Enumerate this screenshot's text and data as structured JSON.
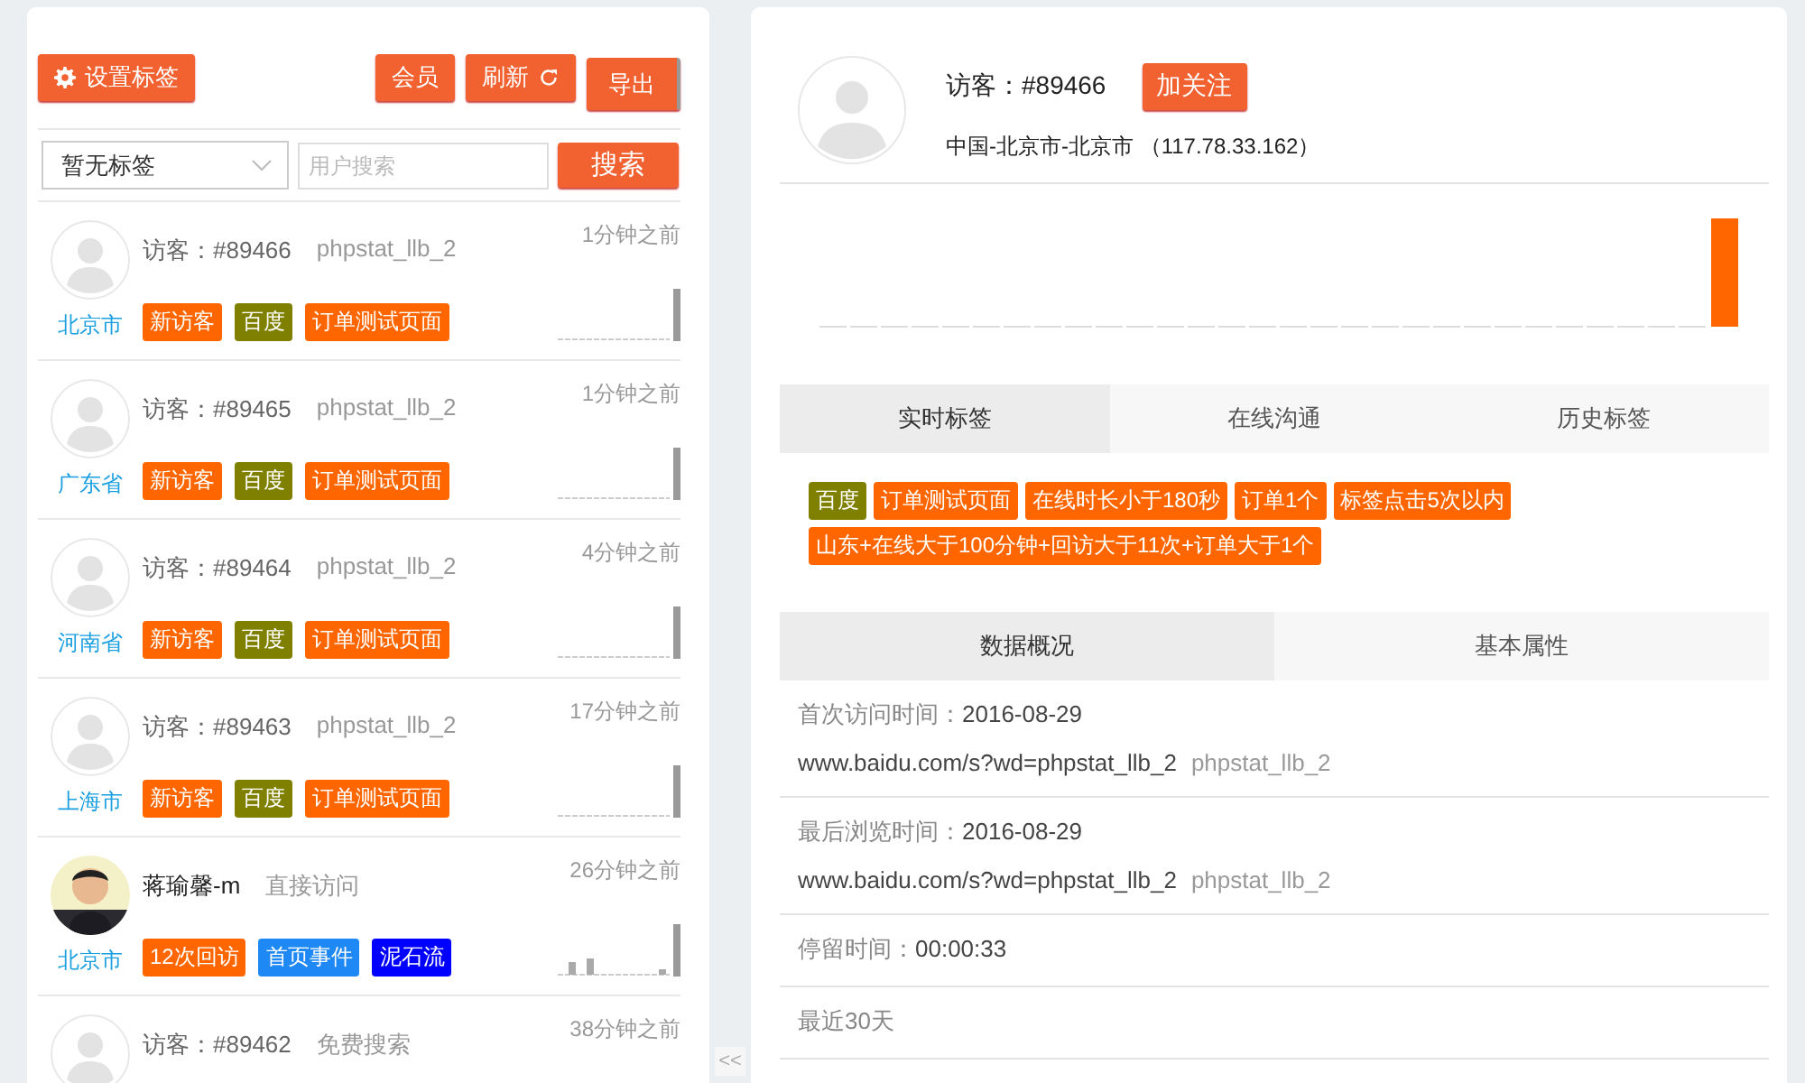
{
  "toolbar": {
    "buttons": [
      {
        "label": "设置标签",
        "kind": "settings"
      },
      {
        "label": "会员",
        "kind": "plain"
      },
      {
        "label": "刷新",
        "kind": "refresh"
      },
      {
        "label": "导出",
        "kind": "export"
      }
    ]
  },
  "filter": {
    "select_value": "暂无标签",
    "search_placeholder": "用户搜索",
    "search_button": "搜索"
  },
  "visitors": [
    {
      "kind": "anonymous",
      "name": "访客：#89466",
      "source": "phpstat_llb_2",
      "time": "1分钟之前",
      "location": "北京市",
      "tags": [
        {
          "label": "新访客",
          "color": "#ff6600"
        },
        {
          "label": "百度",
          "color": "#808000"
        },
        {
          "label": "订单测试页面",
          "color": "#ff6600"
        }
      ]
    },
    {
      "kind": "anonymous",
      "name": "访客：#89465",
      "source": "phpstat_llb_2",
      "time": "1分钟之前",
      "location": "广东省",
      "tags": [
        {
          "label": "新访客",
          "color": "#ff6600"
        },
        {
          "label": "百度",
          "color": "#808000"
        },
        {
          "label": "订单测试页面",
          "color": "#ff6600"
        }
      ]
    },
    {
      "kind": "anonymous",
      "name": "访客：#89464",
      "source": "phpstat_llb_2",
      "time": "4分钟之前",
      "location": "河南省",
      "tags": [
        {
          "label": "新访客",
          "color": "#ff6600"
        },
        {
          "label": "百度",
          "color": "#808000"
        },
        {
          "label": "订单测试页面",
          "color": "#ff6600"
        }
      ]
    },
    {
      "kind": "anonymous",
      "name": "访客：#89463",
      "source": "phpstat_llb_2",
      "time": "17分钟之前",
      "location": "上海市",
      "tags": [
        {
          "label": "新访客",
          "color": "#ff6600"
        },
        {
          "label": "百度",
          "color": "#808000"
        },
        {
          "label": "订单测试页面",
          "color": "#ff6600"
        }
      ]
    },
    {
      "kind": "member",
      "name": "蒋瑜馨-m",
      "source": "直接访问",
      "time": "26分钟之前",
      "location": "北京市",
      "tags": [
        {
          "label": "12次回访",
          "color": "#ff6600"
        },
        {
          "label": "首页事件",
          "color": "#1e88f5"
        },
        {
          "label": "泥石流",
          "color": "#0000ff"
        }
      ]
    },
    {
      "kind": "anonymous",
      "name": "访客：#89462",
      "source": "免费搜索",
      "time": "38分钟之前"
    }
  ],
  "detail": {
    "name": "访客：#89466",
    "follow_button": "加关注",
    "location": "中国-北京市-北京市 （117.78.33.162）",
    "tabs": [
      {
        "label": "实时标签",
        "selected": true
      },
      {
        "label": "在线沟通",
        "selected": false
      },
      {
        "label": "历史标签",
        "selected": false
      }
    ],
    "tags": [
      {
        "label": "百度",
        "color": "#808000"
      },
      {
        "label": "订单测试页面",
        "color": "#ff6600"
      },
      {
        "label": "在线时长小于180秒",
        "color": "#ff6600"
      },
      {
        "label": "订单1个",
        "color": "#ff6600"
      },
      {
        "label": "标签点击5次以内",
        "color": "#ff6600"
      },
      {
        "label": "山东+在线大于100分钟+回访大于11次+订单大于1个",
        "color": "#ff6600"
      }
    ],
    "subtabs": [
      {
        "label": "数据概况",
        "selected": true
      },
      {
        "label": "基本属性",
        "selected": false
      }
    ],
    "sections": [
      {
        "label": "首次访问时间：",
        "value": "2016-08-29",
        "url": "www.baidu.com/s?wd=phpstat_llb_2",
        "source": "phpstat_llb_2"
      },
      {
        "label": "最后浏览时间：",
        "value": "2016-08-29",
        "url": "www.baidu.com/s?wd=phpstat_llb_2",
        "source": "phpstat_llb_2"
      },
      {
        "label": "停留时间：",
        "value": "00:00:33"
      },
      {
        "label": "最近30天"
      }
    ]
  },
  "collapse_handle": "<<"
}
